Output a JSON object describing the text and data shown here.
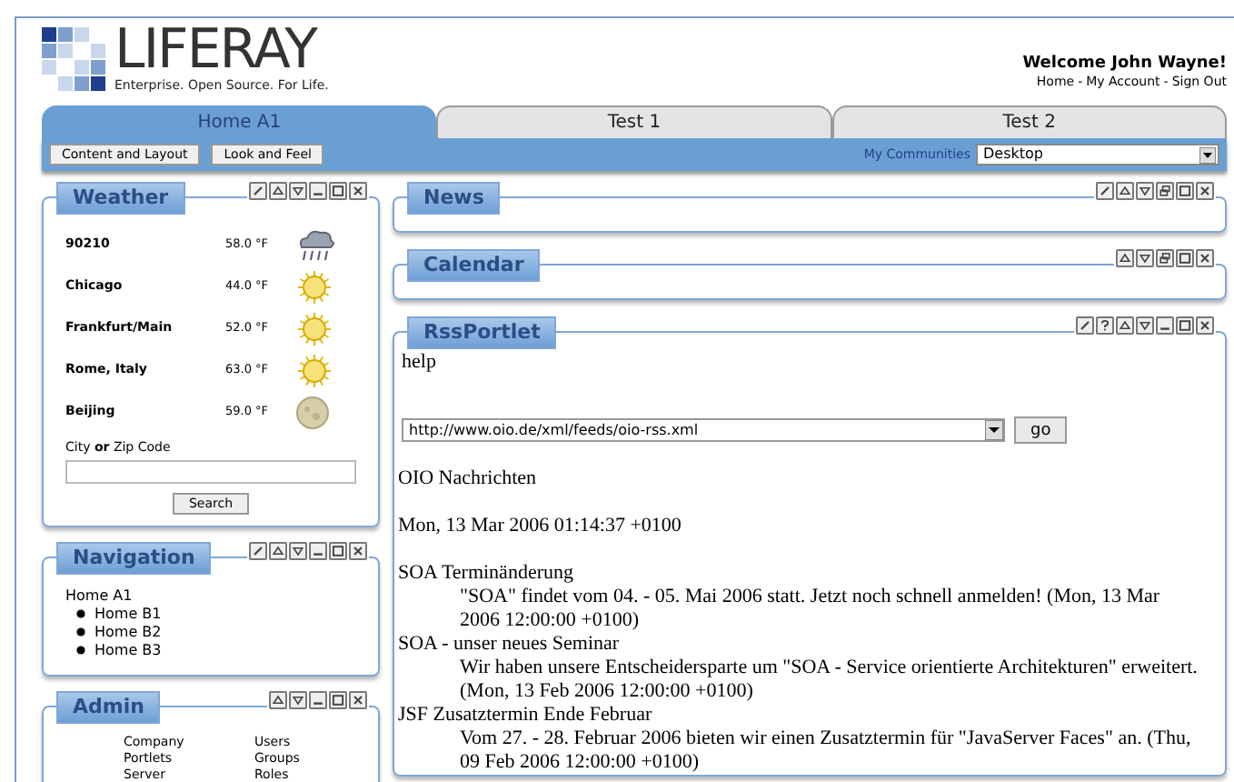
{
  "header": {
    "logo_text": "LIFERAY",
    "tagline": "Enterprise. Open Source. For Life.",
    "welcome": "Welcome John Wayne!",
    "links": [
      "Home",
      "My Account",
      "Sign Out"
    ],
    "link_separator": "-"
  },
  "tabs": [
    {
      "label": "Home A1",
      "selected": true
    },
    {
      "label": "Test 1",
      "selected": false
    },
    {
      "label": "Test 2",
      "selected": false
    }
  ],
  "toolbar": {
    "buttons": [
      "Content and Layout",
      "Look and Feel"
    ],
    "communities_label": "My Communities",
    "communities_value": "Desktop"
  },
  "weather": {
    "title": "Weather",
    "buttons": [
      {
        "kind": "edit"
      },
      {
        "kind": "up"
      },
      {
        "kind": "down"
      },
      {
        "kind": "minimize"
      },
      {
        "kind": "maximize"
      },
      {
        "kind": "close"
      }
    ],
    "rows": [
      {
        "place": "90210",
        "temp": "58.0 °F",
        "kind": "rain"
      },
      {
        "place": "Chicago",
        "temp": "44.0 °F",
        "kind": "sun"
      },
      {
        "place": "Frankfurt/Main",
        "temp": "52.0 °F",
        "kind": "sun"
      },
      {
        "place": "Rome, Italy",
        "temp": "63.0 °F",
        "kind": "sun"
      },
      {
        "place": "Beijing",
        "temp": "59.0 °F",
        "kind": "moon"
      }
    ],
    "field_label": "City **or** Zip Code",
    "search_button": "Search"
  },
  "navigation": {
    "title": "Navigation",
    "buttons": [
      {
        "kind": "edit"
      },
      {
        "kind": "up"
      },
      {
        "kind": "down"
      },
      {
        "kind": "minimize"
      },
      {
        "kind": "maximize"
      },
      {
        "kind": "close"
      }
    ],
    "items": [
      {
        "label": "Home A1",
        "children": [
          {
            "label": "Home B1"
          },
          {
            "label": "Home B2"
          },
          {
            "label": "Home B3"
          }
        ]
      }
    ]
  },
  "admin": {
    "title": "Admin",
    "buttons": [
      {
        "kind": "up"
      },
      {
        "kind": "down"
      },
      {
        "kind": "minimize"
      },
      {
        "kind": "maximize"
      },
      {
        "kind": "close"
      }
    ],
    "links": [
      "Company",
      "Users",
      "Portlets",
      "Groups",
      "Server",
      "Roles"
    ]
  },
  "news": {
    "title": "News",
    "buttons": [
      {
        "kind": "edit"
      },
      {
        "kind": "up"
      },
      {
        "kind": "down"
      },
      {
        "kind": "restore"
      },
      {
        "kind": "maximize"
      },
      {
        "kind": "close"
      }
    ]
  },
  "calendar": {
    "title": "Calendar",
    "buttons": [
      {
        "kind": "up"
      },
      {
        "kind": "down"
      },
      {
        "kind": "restore"
      },
      {
        "kind": "maximize"
      },
      {
        "kind": "close"
      }
    ]
  },
  "rss": {
    "title": "RssPortlet",
    "buttons": [
      {
        "kind": "edit"
      },
      {
        "kind": "help"
      },
      {
        "kind": "up"
      },
      {
        "kind": "down"
      },
      {
        "kind": "minimize"
      },
      {
        "kind": "maximize"
      },
      {
        "kind": "close"
      }
    ],
    "help": "help",
    "feed_url": "http://www.oio.de/xml/feeds/oio-rss.xml",
    "go_button": "go",
    "feed_title": "OIO Nachrichten",
    "feed_date": "Mon, 13 Mar 2006 01:14:37 +0100",
    "entries": [
      {
        "title": "SOA Terminänderung",
        "body": "\"SOA\" findet vom 04. - 05. Mai 2006 statt. Jetzt noch schnell anmelden! (Mon, 13 Mar 2006 12:00:00 +0100)"
      },
      {
        "title": "SOA - unser neues Seminar",
        "body": "Wir haben unsere Entscheidersparte um \"SOA - Service orientierte Architekturen\" erweitert. (Mon, 13 Feb 2006 12:00:00 +0100)"
      },
      {
        "title": "JSF Zusatztermin Ende Februar",
        "body": "Vom 27. - 28. Februar 2006 bieten wir einen Zusatztermin für \"JavaServer Faces\" an. (Thu, 09 Feb 2006 12:00:00 +0100)"
      }
    ]
  }
}
